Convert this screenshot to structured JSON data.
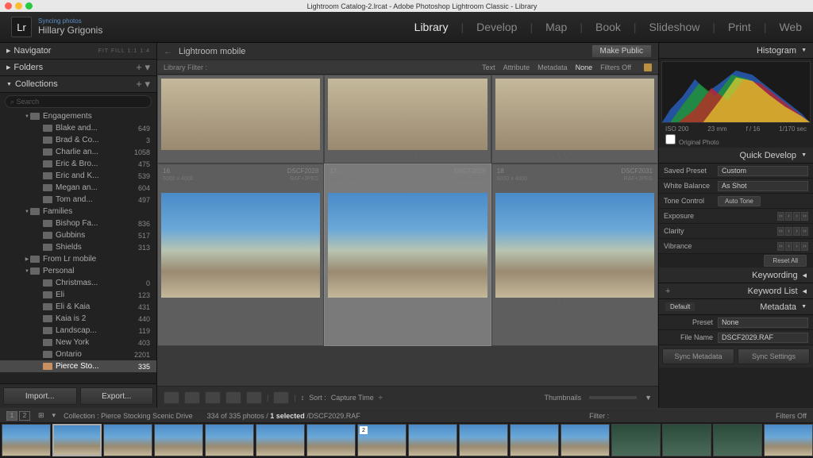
{
  "titlebar": {
    "title": "Lightroom Catalog-2.lrcat - Adobe Photoshop Lightroom Classic - Library"
  },
  "logo": {
    "mark": "Lr",
    "sync": "Syncing photos",
    "name": "Hillary Grigonis"
  },
  "modules": [
    "Library",
    "Develop",
    "Map",
    "Book",
    "Slideshow",
    "Print",
    "Web"
  ],
  "modules_active": 0,
  "left": {
    "navigator": {
      "label": "Navigator",
      "sub": "FIT FILL 1:1 1:4"
    },
    "folders": {
      "label": "Folders"
    },
    "collections": {
      "label": "Collections"
    },
    "search_placeholder": "Search",
    "tree": [
      {
        "d": 2,
        "tri": "▼",
        "label": "Engagements",
        "count": ""
      },
      {
        "d": 3,
        "tri": "",
        "label": "Blake and...",
        "count": "649"
      },
      {
        "d": 3,
        "tri": "",
        "label": "Brad & Co...",
        "count": "3"
      },
      {
        "d": 3,
        "tri": "",
        "label": "Charlie an...",
        "count": "1058"
      },
      {
        "d": 3,
        "tri": "",
        "label": "Eric & Bro...",
        "count": "475"
      },
      {
        "d": 3,
        "tri": "",
        "label": "Eric and K...",
        "count": "539"
      },
      {
        "d": 3,
        "tri": "",
        "label": "Megan an...",
        "count": "604"
      },
      {
        "d": 3,
        "tri": "",
        "label": "Tom and...",
        "count": "497"
      },
      {
        "d": 2,
        "tri": "▼",
        "label": "Families",
        "count": ""
      },
      {
        "d": 3,
        "tri": "",
        "label": "Bishop Fa...",
        "count": "836"
      },
      {
        "d": 3,
        "tri": "",
        "label": "Gubbins",
        "count": "517"
      },
      {
        "d": 3,
        "tri": "",
        "label": "Shields",
        "count": "313"
      },
      {
        "d": 2,
        "tri": "▶",
        "label": "From Lr mobile",
        "count": ""
      },
      {
        "d": 2,
        "tri": "▼",
        "label": "Personal",
        "count": ""
      },
      {
        "d": 3,
        "tri": "",
        "label": "Christmas...",
        "count": "0"
      },
      {
        "d": 3,
        "tri": "",
        "label": "Eli",
        "count": "123"
      },
      {
        "d": 3,
        "tri": "",
        "label": "Eli & Kaia",
        "count": "431"
      },
      {
        "d": 3,
        "tri": "",
        "label": "Kaia is 2",
        "count": "440"
      },
      {
        "d": 3,
        "tri": "",
        "label": "Landscap...",
        "count": "119"
      },
      {
        "d": 3,
        "tri": "",
        "label": "New York",
        "count": "403"
      },
      {
        "d": 3,
        "tri": "",
        "label": "Ontario",
        "count": "2201"
      },
      {
        "d": 3,
        "tri": "",
        "label": "Pierce Sto...",
        "count": "335",
        "sel": true
      }
    ],
    "import": "Import...",
    "export": "Export..."
  },
  "breadcrumb": {
    "arrow": "←",
    "path": "Lightroom mobile",
    "make_public": "Make Public"
  },
  "filter": {
    "label": "Library Filter :",
    "opts": [
      "Text",
      "Attribute",
      "Metadata",
      "None"
    ],
    "active": 3,
    "off": "Filters Off"
  },
  "grid_cells": [
    {
      "num": "16",
      "dims": "6000 x 4000",
      "name": "DSCF2028",
      "fmt": "RAF+JPEG"
    },
    {
      "num": "17",
      "dims": "5666 x 3778",
      "name": "DSCF2029",
      "fmt": "RAF+JPEG",
      "sel": true
    },
    {
      "num": "18",
      "dims": "6000 x 4000",
      "name": "DSCF2031",
      "fmt": "RAF+JPEG"
    }
  ],
  "toolbar": {
    "sort_label": "Sort :",
    "sort_val": "Capture Time",
    "thumbs": "Thumbnails"
  },
  "right": {
    "histogram": "Histogram",
    "histo_info": {
      "iso": "ISO 200",
      "fl": "23 mm",
      "ap": "f / 16",
      "ss": "1/170 sec"
    },
    "orig": "Original Photo",
    "quick_develop": "Quick Develop",
    "saved_preset": {
      "label": "Saved Preset",
      "value": "Custom"
    },
    "white_balance": {
      "label": "White Balance",
      "value": "As Shot"
    },
    "tone_control": {
      "label": "Tone Control",
      "btn": "Auto Tone"
    },
    "exposure": "Exposure",
    "clarity": "Clarity",
    "vibrance": "Vibrance",
    "reset": "Reset All",
    "keywording": "Keywording",
    "keyword_list": "Keyword List",
    "metadata": {
      "label": "Metadata",
      "default": "Default",
      "preset_lbl": "Preset",
      "preset_val": "None",
      "filename_lbl": "File Name",
      "filename_val": "DSCF2029.RAF"
    },
    "sync_meta": "Sync Metadata",
    "sync_set": "Sync Settings"
  },
  "info": {
    "pages": [
      "1",
      "2"
    ],
    "collection": "Collection : Pierce Stocking Scenic Drive",
    "count": "334 of 335 photos /",
    "selected": "1 selected",
    "file": "/DSCF2029.RAF",
    "filter": "Filter :",
    "filters_off": "Filters Off"
  }
}
